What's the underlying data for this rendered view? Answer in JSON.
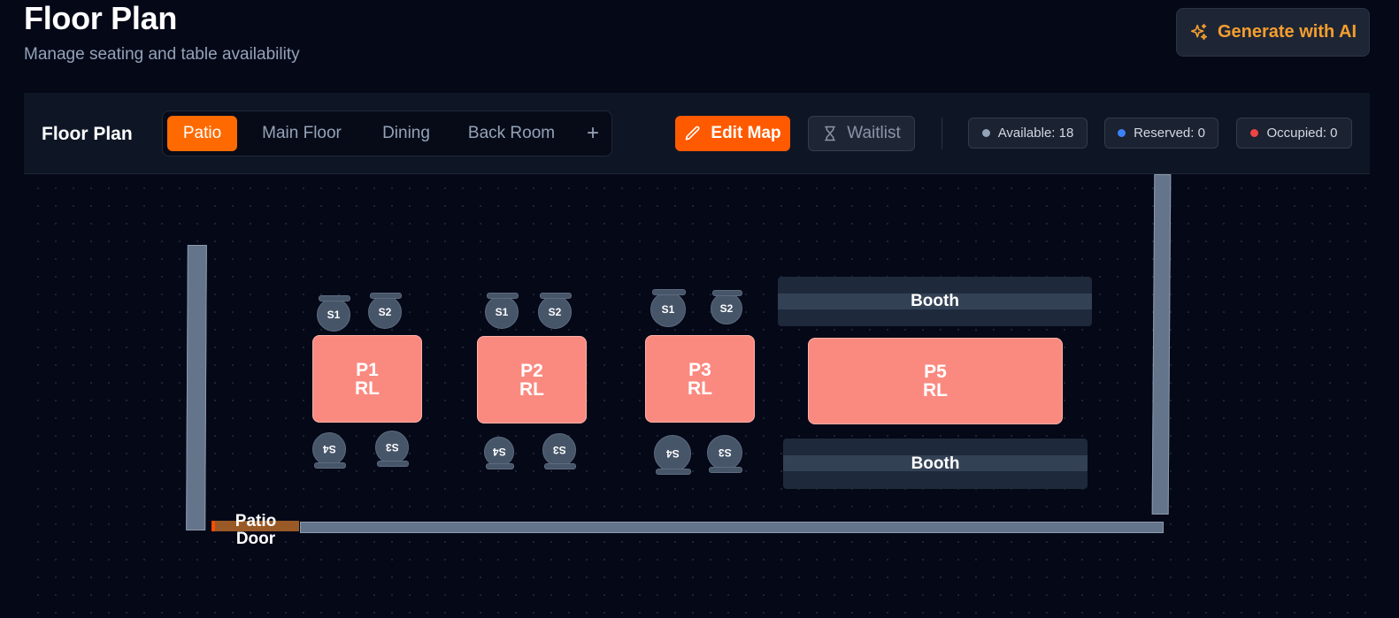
{
  "header": {
    "title": "Floor Plan",
    "subtitle": "Manage seating and table availability",
    "generate_label": "Generate with AI"
  },
  "toolbar": {
    "title": "Floor Plan",
    "tabs": [
      {
        "label": "Patio",
        "active": true
      },
      {
        "label": "Main Floor",
        "active": false
      },
      {
        "label": "Dining",
        "active": false
      },
      {
        "label": "Back Room",
        "active": false
      }
    ],
    "add_tab_symbol": "+",
    "edit_map_label": "Edit Map",
    "waitlist_label": "Waitlist",
    "status": {
      "available": "Available: 18",
      "reserved": "Reserved: 0",
      "occupied": "Occupied: 0"
    }
  },
  "colors": {
    "accent": "#ff5a00",
    "ai_accent": "#f59e2e",
    "table_fill": "#fa8a80",
    "available_dot": "#94a3b8",
    "reserved_dot": "#3b82f6",
    "occupied_dot": "#ef4444"
  },
  "floor": {
    "door_label": "Patio Door",
    "tables": [
      {
        "id": "P1",
        "tag": "RL",
        "seats": [
          "S1",
          "S2",
          "S4",
          "S3"
        ]
      },
      {
        "id": "P2",
        "tag": "RL",
        "seats": [
          "S1",
          "S2",
          "S4",
          "S3"
        ]
      },
      {
        "id": "P3",
        "tag": "RL",
        "seats": [
          "S1",
          "S2",
          "S4",
          "S3"
        ]
      },
      {
        "id": "P5",
        "tag": "RL",
        "seats": []
      }
    ],
    "booths": [
      "Booth",
      "Booth"
    ]
  }
}
